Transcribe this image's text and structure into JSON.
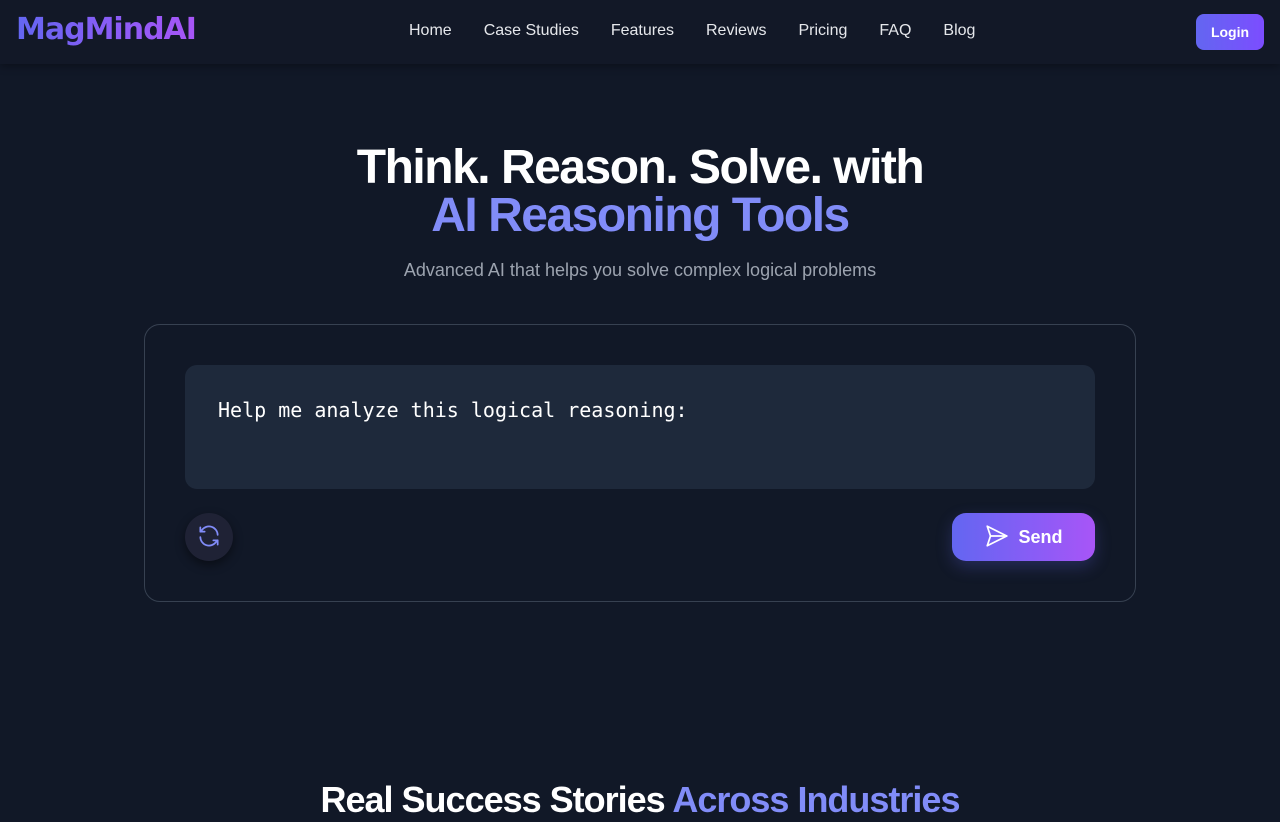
{
  "brand": {
    "logo_text": "MagMindAI"
  },
  "nav": {
    "items": [
      {
        "label": "Home"
      },
      {
        "label": "Case Studies"
      },
      {
        "label": "Features"
      },
      {
        "label": "Reviews"
      },
      {
        "label": "Pricing"
      },
      {
        "label": "FAQ"
      },
      {
        "label": "Blog"
      }
    ],
    "login_label": "Login"
  },
  "hero": {
    "title_line1": "Think. Reason. Solve. with",
    "title_line2": "AI Reasoning Tools",
    "subtitle": "Advanced AI that helps you solve complex logical problems"
  },
  "composer": {
    "input_value": "Help me analyze this logical reasoning:",
    "refresh_icon": "refresh-icon",
    "send_icon": "send-icon",
    "send_label": "Send"
  },
  "section": {
    "title_plain": "Real Success Stories ",
    "title_accent": "Across Industries"
  },
  "colors": {
    "background": "#111827",
    "accent": "#818cf8",
    "brand_gradient_start": "#6366f1",
    "brand_gradient_end": "#a855f7",
    "input_bg": "#1e293b",
    "muted_text": "#9ca3af"
  }
}
